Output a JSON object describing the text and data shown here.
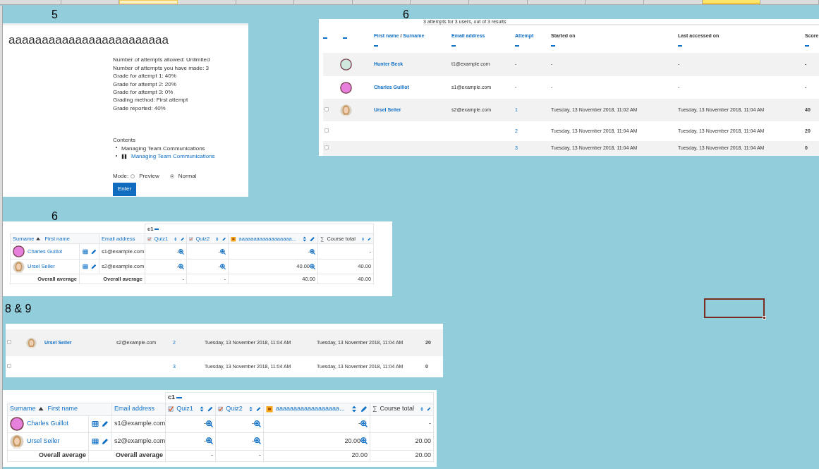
{
  "sheet": {
    "column_headers": [
      {
        "selected": false,
        "highlighted": false
      },
      {
        "selected": false,
        "highlighted": false
      },
      {
        "selected": false,
        "highlighted": true
      },
      {
        "selected": false,
        "highlighted": false
      },
      {
        "selected": false,
        "highlighted": false
      },
      {
        "selected": false,
        "highlighted": false
      },
      {
        "selected": false,
        "highlighted": false
      },
      {
        "selected": false,
        "highlighted": false
      },
      {
        "selected": false,
        "highlighted": false
      },
      {
        "selected": false,
        "highlighted": false
      },
      {
        "selected": false,
        "highlighted": false
      },
      {
        "selected": false,
        "highlighted": false
      },
      {
        "selected": true,
        "highlighted": false
      },
      {
        "selected": false,
        "highlighted": false
      }
    ],
    "labels": [
      {
        "text": "5"
      },
      {
        "text": "6"
      },
      {
        "text": "6"
      },
      {
        "text": "8 & 9"
      }
    ]
  },
  "quiz_info": {
    "title": "aaaaaaaaaaaaaaaaaaaaaaaa",
    "details": [
      "Number of attempts allowed: Unlimited",
      "Number of attempts you have made: 3",
      "Grade for attempt 1: 40%",
      "Grade for attempt 2: 20%",
      "Grade for attempt 3: 0%",
      "Grading method: First attempt",
      "Grade reported: 40%"
    ],
    "contents_heading": "Contents",
    "contents": [
      {
        "text": "Managing Team Communications",
        "kind": "plain"
      },
      {
        "text": "Managing Team Communications",
        "kind": "link"
      }
    ],
    "mode_label": "Mode:",
    "modes": [
      {
        "label": "Preview",
        "selected": false
      },
      {
        "label": "Normal",
        "selected": true
      }
    ],
    "button": "Enter"
  },
  "attempts_report": {
    "summary": "3 attempts for 3 users, out of 3 results",
    "columns": [
      {
        "kind": "select"
      },
      {
        "kind": "avatar"
      },
      {
        "kind": "link",
        "labels": [
          "First name",
          "Surname"
        ],
        "separator": "/"
      },
      {
        "kind": "link",
        "labels": [
          "Email address"
        ]
      },
      {
        "kind": "link",
        "labels": [
          "Attempt"
        ]
      },
      {
        "kind": "plain",
        "labels": [
          "Started on"
        ]
      },
      {
        "kind": "plain",
        "labels": [
          "Last accessed on"
        ]
      },
      {
        "kind": "plain",
        "labels": [
          "Score"
        ]
      }
    ],
    "rows": [
      {
        "avatar": {
          "kind": "cartoon",
          "color": "#cfe7dc"
        },
        "name": "Hunter Beck",
        "email": "t1@example.com",
        "attempt": "-",
        "started": "-",
        "last_accessed": "-",
        "score": "-"
      },
      {
        "avatar": {
          "kind": "cartoon",
          "color": "#e680dc"
        },
        "name": "Charles Guillot",
        "email": "s1@example.com",
        "attempt": "-",
        "started": "-",
        "last_accessed": "-",
        "score": "-"
      },
      {
        "checked": false,
        "avatar": {
          "kind": "photo"
        },
        "name": "Ursel Seiler",
        "email": "s2@example.com",
        "attempt": "1",
        "attempt_linked": true,
        "started": "Tuesday, 13 November 2018, 11:02 AM",
        "last_accessed": "Tuesday, 13 November 2018, 11:04 AM",
        "score": "40"
      },
      {
        "checked": false,
        "attempt": "2",
        "attempt_linked": true,
        "started": "Tuesday, 13 November 2018, 11:04 AM",
        "last_accessed": "Tuesday, 13 November 2018, 11:04 AM",
        "score": "20"
      },
      {
        "checked": false,
        "attempt": "3",
        "attempt_linked": true,
        "started": "Tuesday, 13 November 2018, 11:04 AM",
        "last_accessed": "Tuesday, 13 November 2018, 11:04 AM",
        "score": "0"
      }
    ]
  },
  "attempts_excerpt": {
    "rows": [
      {
        "checked": false,
        "avatar": {
          "kind": "photo"
        },
        "name": "Ursel Seiler",
        "email": "s2@example.com",
        "attempt": "2",
        "attempt_linked": true,
        "started": "Tuesday, 13 November 2018, 11:04 AM",
        "last_accessed": "Tuesday, 13 November 2018, 11:04 AM",
        "score": "20"
      },
      {
        "checked": false,
        "attempt": "3",
        "attempt_linked": true,
        "started": "Tuesday, 13 November 2018, 11:04 AM",
        "last_accessed": "Tuesday, 13 November 2018, 11:04 AM",
        "score": "0"
      }
    ]
  },
  "grader_reports": [
    {
      "category": "c1",
      "name_labels": [
        "Surname",
        "First name"
      ],
      "columns": [
        {
          "kind": "email",
          "label": "Email address"
        },
        {
          "kind": "quiz",
          "label": "Quiz1"
        },
        {
          "kind": "quiz",
          "label": "Quiz2"
        },
        {
          "kind": "assignment",
          "label": "aaaaaaaaaaaaaaaaaa..."
        },
        {
          "kind": "total",
          "label": "Course total",
          "icon": "∑"
        }
      ],
      "rows": [
        {
          "avatar": {
            "kind": "cartoon",
            "color": "#e680dc"
          },
          "name": "Charles Guillot",
          "email": "s1@example.com",
          "grades": [
            "-",
            "-",
            "-",
            "-"
          ]
        },
        {
          "avatar": {
            "kind": "photo"
          },
          "name": "Ursel Seiler",
          "email": "s2@example.com",
          "grades": [
            "-",
            "-",
            "40.00",
            "40.00"
          ]
        }
      ],
      "average": {
        "labels": [
          "Overall average",
          "Overall average"
        ],
        "grades": [
          "-",
          "-",
          "40.00",
          "40.00"
        ]
      }
    },
    {
      "category": "c1",
      "name_labels": [
        "Surname",
        "First name"
      ],
      "columns": [
        {
          "kind": "email",
          "label": "Email address"
        },
        {
          "kind": "quiz",
          "label": "Quiz1"
        },
        {
          "kind": "quiz",
          "label": "Quiz2"
        },
        {
          "kind": "assignment",
          "label": "aaaaaaaaaaaaaaaaaa..."
        },
        {
          "kind": "total",
          "label": "Course total",
          "icon": "∑"
        }
      ],
      "rows": [
        {
          "avatar": {
            "kind": "cartoon",
            "color": "#e680dc"
          },
          "name": "Charles Guillot",
          "email": "s1@example.com",
          "grades": [
            "-",
            "-",
            "-",
            "-"
          ]
        },
        {
          "avatar": {
            "kind": "photo"
          },
          "name": "Ursel Seiler",
          "email": "s2@example.com",
          "grades": [
            "-",
            "-",
            "20.00",
            "20.00"
          ]
        }
      ],
      "average": {
        "labels": [
          "Overall average",
          "Overall average"
        ],
        "grades": [
          "-",
          "-",
          "20.00",
          "20.00"
        ]
      }
    }
  ]
}
